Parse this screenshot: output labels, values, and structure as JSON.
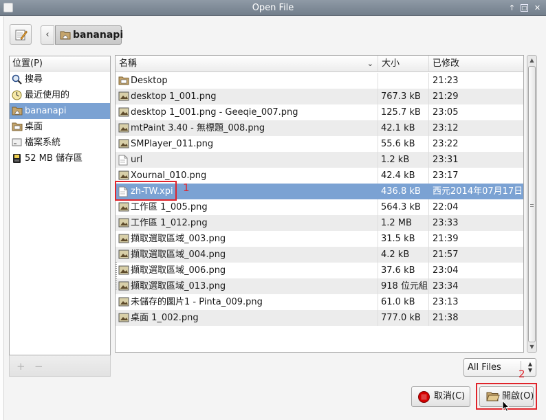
{
  "window": {
    "title": "Open File",
    "controls": {
      "up": "↑",
      "maximize": "□",
      "close": "✕"
    }
  },
  "toolbar": {
    "back_label": "‹",
    "path_label": "bananapi"
  },
  "places": {
    "header": "位置(P)",
    "items": [
      {
        "label": "搜尋",
        "icon": "search-icon"
      },
      {
        "label": "最近使用的",
        "icon": "recent-icon"
      },
      {
        "label": "bananapi",
        "icon": "home-folder-icon",
        "selected": true
      },
      {
        "label": "桌面",
        "icon": "desktop-folder-icon"
      },
      {
        "label": "檔案系統",
        "icon": "drive-icon"
      },
      {
        "label": "52 MB 儲存區",
        "icon": "usb-drive-icon"
      }
    ],
    "add_label": "+",
    "remove_label": "−"
  },
  "files": {
    "columns": {
      "name": "名稱",
      "size": "大小",
      "modified": "已修改"
    },
    "rows": [
      {
        "name": "Desktop",
        "size": "",
        "modified": "21:23",
        "type": "folder"
      },
      {
        "name": "desktop 1_001.png",
        "size": "767.3 kB",
        "modified": "21:29",
        "type": "image"
      },
      {
        "name": "desktop 1_001.png - Geeqie_007.png",
        "size": "125.7 kB",
        "modified": "23:05",
        "type": "image"
      },
      {
        "name": "mtPaint 3.40 - 無標題_008.png",
        "size": "42.1 kB",
        "modified": "23:12",
        "type": "image"
      },
      {
        "name": "SMPlayer_011.png",
        "size": "55.6 kB",
        "modified": "23:22",
        "type": "image"
      },
      {
        "name": "url",
        "size": "1.2 kB",
        "modified": "23:31",
        "type": "text"
      },
      {
        "name": "Xournal_010.png",
        "size": "42.4 kB",
        "modified": "23:17",
        "type": "image"
      },
      {
        "name": "zh-TW.xpi",
        "size": "436.8 kB",
        "modified": "西元2014年07月17日",
        "type": "text",
        "selected": true
      },
      {
        "name": "工作區 1_005.png",
        "size": "564.3 kB",
        "modified": "22:04",
        "type": "image"
      },
      {
        "name": "工作區 1_012.png",
        "size": "1.2 MB",
        "modified": "23:33",
        "type": "image"
      },
      {
        "name": "擷取選取區域_003.png",
        "size": "31.5 kB",
        "modified": "21:39",
        "type": "image"
      },
      {
        "name": "擷取選取區域_004.png",
        "size": "4.2 kB",
        "modified": "21:57",
        "type": "image"
      },
      {
        "name": "擷取選取區域_006.png",
        "size": "37.6 kB",
        "modified": "23:04",
        "type": "image"
      },
      {
        "name": "擷取選取區域_013.png",
        "size": "918 位元組",
        "modified": "23:34",
        "type": "image"
      },
      {
        "name": "未儲存的圖片1 - Pinta_009.png",
        "size": "61.0 kB",
        "modified": "23:13",
        "type": "image"
      },
      {
        "name": "桌面 1_002.png",
        "size": "777.0 kB",
        "modified": "21:38",
        "type": "image"
      }
    ]
  },
  "filter": {
    "value": "All Files"
  },
  "buttons": {
    "cancel": "取消(C)",
    "open": "開啟(O)"
  },
  "annotations": {
    "one": "1",
    "two": "2"
  },
  "colors": {
    "selection": "#7ba2d3",
    "annotation": "#e0242b",
    "cancel_icon": "#d40000"
  }
}
